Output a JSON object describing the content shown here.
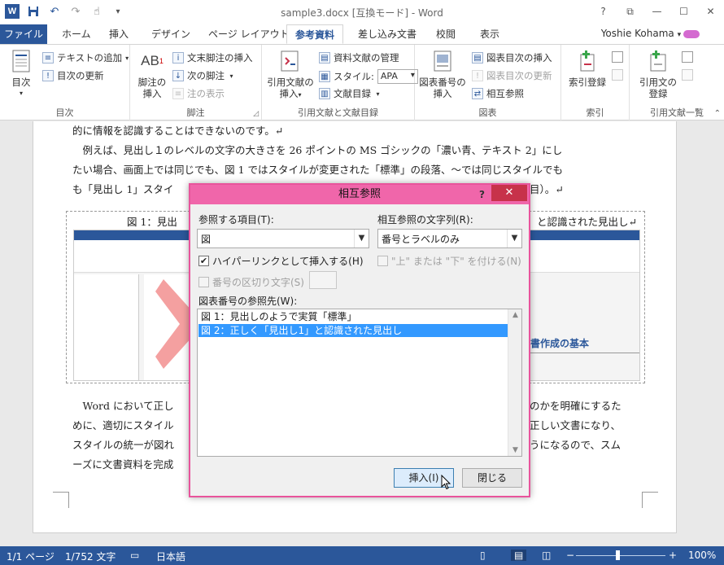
{
  "window": {
    "title": "sample3.docx [互換モード] - Word",
    "help": "?",
    "restore": "⧉",
    "minimize": "—",
    "maximize": "☐",
    "close": "✕"
  },
  "qat": {
    "undo": "↶",
    "redo": "↷"
  },
  "tabs": {
    "file": "ファイル",
    "home": "ホーム",
    "insert": "挿入",
    "design": "デザイン",
    "layout": "ページ レイアウト",
    "references": "参考資料",
    "mailings": "差し込み文書",
    "review": "校閲",
    "view": "表示"
  },
  "user": {
    "name": "Yoshie Kohama"
  },
  "ribbon": {
    "toc": {
      "group": "目次",
      "toc_button": "目次",
      "add_text": "テキストの追加",
      "update_toc": "目次の更新"
    },
    "footnotes": {
      "group": "脚注",
      "insert_footnote": "脚注の\n挿入",
      "insert_endnote": "文末脚注の挿入",
      "next_footnote": "次の脚注",
      "show_notes": "注の表示"
    },
    "citations": {
      "group": "引用文献と文献目録",
      "insert_citation": "引用文献の\n挿入",
      "manage_sources": "資料文献の管理",
      "style_label": "スタイル:",
      "style_value": "APA",
      "bibliography": "文献目録"
    },
    "captions": {
      "group": "図表",
      "insert_caption": "図表番号の\n挿入",
      "insert_table_of_figures": "図表目次の挿入",
      "update_table": "図表目次の更新",
      "cross_reference": "相互参照"
    },
    "index": {
      "group": "索引",
      "mark_entry": "索引登録"
    },
    "authorities": {
      "group": "引用文献一覧",
      "mark_citation": "引用文の\n登録"
    }
  },
  "document": {
    "line1": "的に情報を認識することはできないのです。↵",
    "line2": "　例えば、見出し１のレベルの文字の大きさを 26 ポイントの MS ゴシックの「濃い青、テキスト 2」にし",
    "line3": "たい場合、画面上では同じでも、図 1 ではスタイルが変更された「標準」の段落、～では同じスタイルでも",
    "line4a": "も「見出し 1」スタイ",
    "line4b": "目）。↵",
    "fig_caption_left": "図 1：見出",
    "fig_caption_right": "と認識された見出し↵",
    "fig_heading": "書作成の基本",
    "line5a": "　Word において正し",
    "line5b": "のかを明確にするた",
    "line6a": "めに、適切にスタイル",
    "line6b": "正しい文書になり、",
    "line7a": "スタイルの統一が図れ",
    "line7b": "うになるので、スム",
    "line8a": "ーズに文書資料を完成"
  },
  "dialog": {
    "title": "相互参照",
    "help": "?",
    "close": "✕",
    "ref_type_label": "参照する項目(T):",
    "ref_type_value": "図",
    "insert_ref_label": "相互参照の文字列(R):",
    "insert_ref_value": "番号とラベルのみ",
    "hyperlink_label": "ハイパーリンクとして挿入する(H)",
    "hyperlink_checked": true,
    "above_below_label": "\"上\" または \"下\" を付ける(N)",
    "separator_label": "番号の区切り文字(S)",
    "for_which_label": "図表番号の参照先(W):",
    "items": [
      "図 1：見出しのようで実質「標準」",
      "図 2：正しく「見出し1」と認識された見出し"
    ],
    "selected_index": 1,
    "insert_button": "挿入(I)",
    "close_button": "閉じる"
  },
  "status": {
    "page": "1/1 ページ",
    "words": "1/752 文字",
    "language": "日本語",
    "zoom": "100%",
    "zoom_level": 1.0
  },
  "colors": {
    "accent": "#2b579a",
    "dialog_border": "#e8549c",
    "dialog_title": "#f066aa",
    "selection": "#3399ff"
  }
}
